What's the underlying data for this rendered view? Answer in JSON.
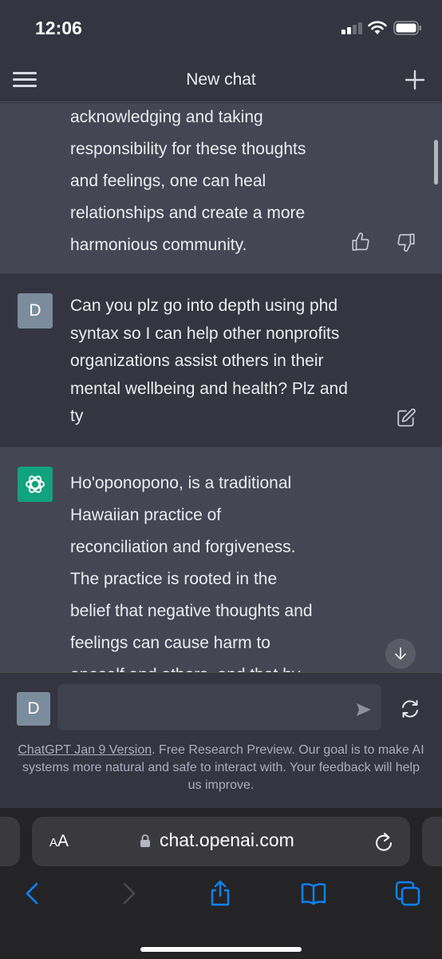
{
  "status_bar": {
    "time": "12:06"
  },
  "nav": {
    "title": "New chat"
  },
  "conversation": {
    "previous_reply": {
      "lines": [
        "acknowledging and taking",
        "responsibility for these thoughts",
        "and feelings, one can heal",
        "relationships and create a more",
        "harmonious community."
      ]
    },
    "user_message": {
      "avatar_letter": "D",
      "lines": [
        "Can you plz go into depth using phd",
        "syntax so I can help other nonprofits",
        "organizations assist others in their",
        "mental wellbeing and health? Plz and",
        "ty"
      ]
    },
    "assistant_reply": {
      "lines": [
        "Ho'oponopono, is a traditional",
        "Hawaiian practice of",
        "reconciliation and forgiveness.",
        "The practice is rooted in the",
        "belief that negative thoughts and",
        "feelings can cause harm to",
        "oneself and others, and that by"
      ]
    }
  },
  "composer": {
    "avatar_letter": "D",
    "input_value": "",
    "disclaimer_link": "ChatGPT Jan 9 Version",
    "disclaimer_text": ". Free Research Preview. Our goal is to make AI systems more natural and safe to interact with. Your feedback will help us improve."
  },
  "browser": {
    "aa_big": "A",
    "aa_small": "A",
    "url": "chat.openai.com"
  },
  "colors": {
    "background": "#343541",
    "assistant_background": "#444654",
    "accent": "#10a37f",
    "user_avatar": "#7b8d9d",
    "ios_blue": "#0a84ff"
  },
  "icons": [
    "hamburger-menu-icon",
    "plus-icon",
    "thumbs-up-icon",
    "thumbs-down-icon",
    "edit-icon",
    "openai-logo-icon",
    "arrow-down-icon",
    "send-icon",
    "regenerate-icon",
    "lock-icon",
    "reload-icon",
    "back-icon",
    "forward-icon",
    "share-icon",
    "bookmarks-icon",
    "tabs-icon"
  ]
}
